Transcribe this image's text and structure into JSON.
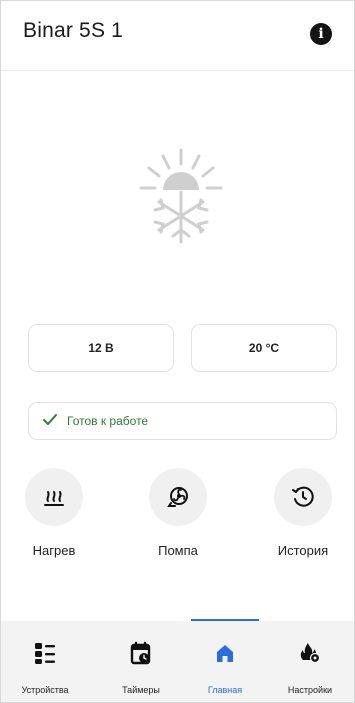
{
  "header": {
    "title": "Binar 5S 1",
    "info_icon": "info-icon"
  },
  "status": {
    "mode_icon": "sun-snowflake-icon",
    "voltage": "12 В",
    "temperature": "20 °C",
    "ready_text": "Готов к работе",
    "ready_icon": "checkmark-icon",
    "ready_color": "#2e7d32"
  },
  "actions": [
    {
      "label": "Нагрев",
      "icon": "heat-icon"
    },
    {
      "label": "Помпа",
      "icon": "pump-icon"
    },
    {
      "label": "История",
      "icon": "history-icon"
    }
  ],
  "tabs": [
    {
      "label": "Устройства",
      "icon": "devices-icon",
      "active": false
    },
    {
      "label": "Таймеры",
      "icon": "calendar-clock-icon",
      "active": false
    },
    {
      "label": "Главная",
      "icon": "home-icon",
      "active": true
    },
    {
      "label": "Настройки",
      "icon": "fire-settings-icon",
      "active": false
    }
  ],
  "colors": {
    "accent": "#2a6de0",
    "icon_gray": "#cfcfcf"
  }
}
